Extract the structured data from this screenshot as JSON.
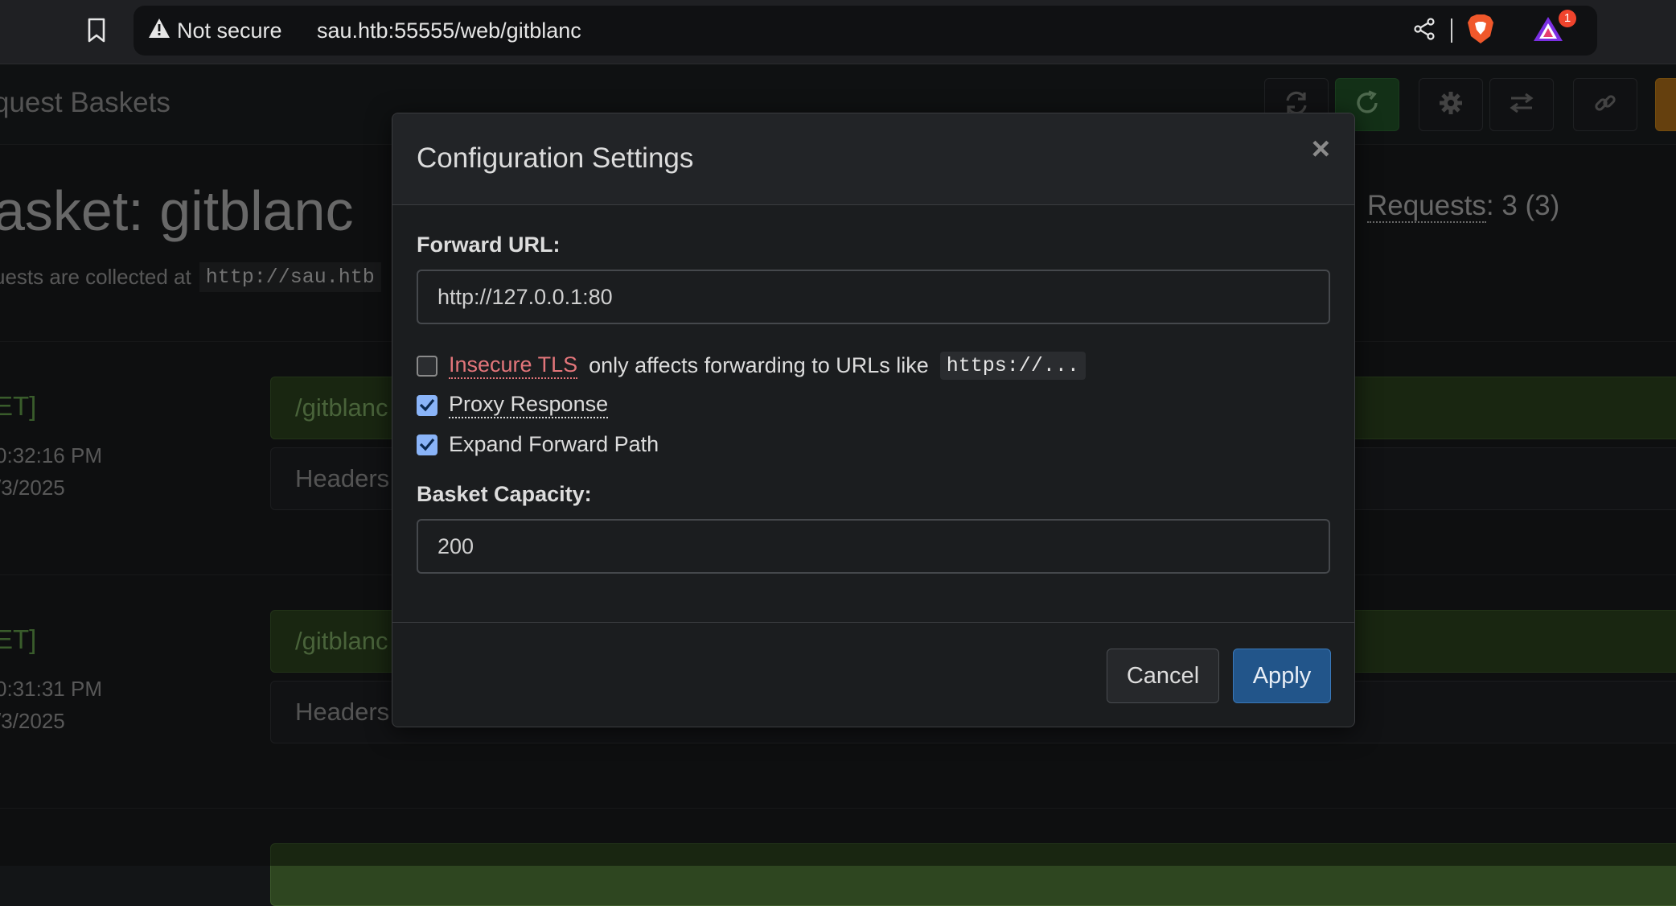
{
  "browser": {
    "security_label": "Not secure",
    "url": "sau.htb:55555/web/gitblanc",
    "notification_count": "1"
  },
  "page": {
    "brand": "quest Baskets",
    "title": "asket: gitblanc",
    "subtitle_prefix": "uests are collected at",
    "subtitle_code": "http://sau.htb",
    "requests_label": "Requests",
    "requests_value": ": 3 (3)",
    "requests": [
      {
        "method": "ET]",
        "time": "0:32:16 PM",
        "date": "/3/2025",
        "path": "/gitblanc",
        "headers": "Headers"
      },
      {
        "method": "ET]",
        "time": "0:31:31 PM",
        "date": "/3/2025",
        "path": "/gitblanc",
        "headers": "Headers"
      },
      {
        "method": "",
        "time": "",
        "date": "",
        "path": "",
        "headers": ""
      }
    ]
  },
  "modal": {
    "title": "Configuration Settings",
    "close": "×",
    "forward_url_label": "Forward URL:",
    "forward_url_value": "http://127.0.0.1:80",
    "insecure_tls_label": "Insecure TLS",
    "insecure_tls_checked": false,
    "insecure_tls_note": "only affects forwarding to URLs like",
    "insecure_tls_code": "https://...",
    "proxy_response_label": "Proxy Response",
    "proxy_response_checked": true,
    "expand_path_label": "Expand Forward Path",
    "expand_path_checked": true,
    "capacity_label": "Basket Capacity:",
    "capacity_value": "200",
    "cancel_label": "Cancel",
    "apply_label": "Apply"
  },
  "colors": {
    "accent": "#22558a",
    "success": "#2e7d32",
    "danger": "#e2757a",
    "warning": "#d08a1a"
  }
}
